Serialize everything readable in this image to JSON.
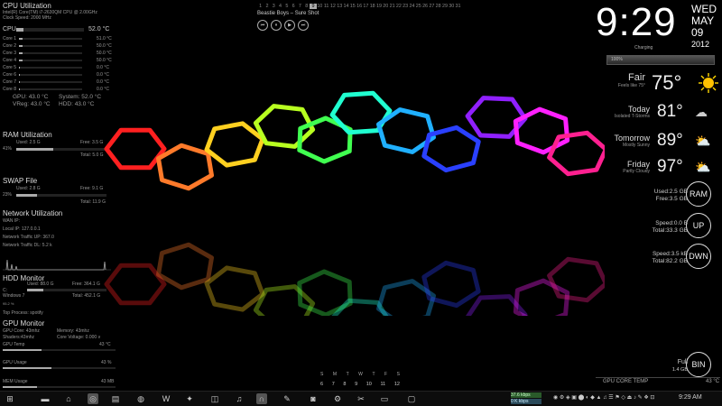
{
  "cpu": {
    "title": "CPU Utilization",
    "model": "Intel(R) Core(TM) i7-2630QM CPU @ 2.00GHz",
    "clock": "Clock Speed: 2000 MHz",
    "label": "CPU",
    "temp": "52.0 °C",
    "cores": [
      {
        "n": "Core 1",
        "t": "51.0 °C"
      },
      {
        "n": "Core 2",
        "t": "50.0 °C"
      },
      {
        "n": "Core 3",
        "t": "50.0 °C"
      },
      {
        "n": "Core 4",
        "t": "50.0 °C"
      },
      {
        "n": "Core 5",
        "t": "0.0 °C"
      },
      {
        "n": "Core 6",
        "t": "0.0 °C"
      },
      {
        "n": "Core 7",
        "t": "0.0 °C"
      },
      {
        "n": "Core 8",
        "t": "0.0 °C"
      }
    ],
    "gpu": "GPU:   43.0 °C",
    "system": "System:  52.0 °C",
    "vreg": "VReg:  43.0 °C",
    "hdd": "HDD:   43.0 °C"
  },
  "ram": {
    "title": "RAM Utilization",
    "used": "Used: 2.5 G",
    "free": "Free: 3.5 G",
    "pct": "41%",
    "total": "Total: 5.0 G",
    "fill": 0.41
  },
  "swap": {
    "title": "SWAP File",
    "used": "Used: 2.8 G",
    "free": "Free: 9.1 G",
    "pct": "23%",
    "total": "Total: 11.9 G",
    "fill": 0.23
  },
  "network": {
    "title": "Network Utilization",
    "wan": "WAN IP:",
    "local": "Local IP:     127.0.0.1",
    "up": "Network Traffic UP:    367.0",
    "dl": "Network Traffic DL:    5.2 k"
  },
  "hdd": {
    "title": "HDD Monitor",
    "used": "Used: 88.0 G",
    "free": "Free: 364.1 G",
    "drive": "C:",
    "os": "Windows 7",
    "total": "Total: 452.1 G",
    "pct": "95.2 %",
    "process": "Top Process: spotify"
  },
  "gpu": {
    "title": "GPU Monitor",
    "core": "GPU Core: 43mhz",
    "memory": "Memory: 43mhz",
    "shaders": "Shaders:43mhz",
    "voltage": "Core Voltage: 0.000 v",
    "temp_label": "GPU Temp",
    "temp": "43 °C",
    "usage_label": "GPU Usage",
    "usage": "43 %",
    "mem_label": "MEM Usage",
    "mem": "43 MB"
  },
  "music": {
    "track": "Beastie Boys – Sure Shot",
    "days": [
      "1",
      "2",
      "3",
      "4",
      "5",
      "6",
      "7",
      "8",
      "9",
      "10",
      "11",
      "12",
      "13",
      "14",
      "15",
      "16",
      "17",
      "18",
      "19",
      "20",
      "21",
      "22",
      "23",
      "24",
      "25",
      "26",
      "27",
      "28",
      "29",
      "30",
      "31"
    ],
    "today_index": 8,
    "controls": [
      "prev-icon",
      "pause-icon",
      "play-icon",
      "next-icon"
    ]
  },
  "clock": {
    "time": "9:29",
    "day": "WED",
    "month": "MAY",
    "date": "09",
    "year": "2012",
    "status": "Charging",
    "battery": "100%"
  },
  "weather": {
    "now": {
      "name": "Fair",
      "sub": "Feels like 75°",
      "temp": "75°"
    },
    "forecast": [
      {
        "name": "Today",
        "sub": "Isolated T-Storms",
        "temp": "81°",
        "icon": "storm-icon"
      },
      {
        "name": "Tomorrow",
        "sub": "Mostly Sunny",
        "temp": "89°",
        "icon": "sun-cloud-icon"
      },
      {
        "name": "Friday",
        "sub": "Partly Cloudy",
        "temp": "97°",
        "icon": "sun-cloud-icon"
      }
    ]
  },
  "meters": {
    "ram": {
      "label": "RAM",
      "l1": "Used:2.5 GB",
      "l2": "Free:3.5 GB"
    },
    "up": {
      "label": "UP",
      "l1": "Speed:0.0 B",
      "l2": "Total:33.3 GB"
    },
    "down": {
      "label": "DWN",
      "l1": "Speed:3.5 kB",
      "l2": "Total:82.2 GB"
    },
    "bin": {
      "label": "BIN",
      "l1": "Full",
      "l2": "1.4 GB"
    }
  },
  "gpu_core": {
    "label": "GPU CORE TEMP",
    "value": "43 °C"
  },
  "mini_cal": {
    "days": [
      "S",
      "M",
      "T",
      "W",
      "T",
      "F",
      "S"
    ],
    "dates": [
      "6",
      "7",
      "8",
      "9",
      "10",
      "11",
      "12"
    ]
  },
  "taskbar": {
    "time": "9:29 AM",
    "net1": "37.6 kbps",
    "net2": "0 K kbps",
    "icons": [
      "start-icon",
      "folder-icon",
      "home-icon",
      "media-icon",
      "document-icon",
      "chrome-icon",
      "word-icon",
      "game-icon",
      "gamepad-icon",
      "music-icon",
      "headphones-icon",
      "paint-icon",
      "camera-icon",
      "gear-icon",
      "tools-icon",
      "terminal-icon",
      "screen-icon"
    ]
  },
  "colors": {
    "ring": [
      "#ff2020",
      "#ff7a2a",
      "#ffd020",
      "#b8ff20",
      "#40ff50",
      "#20ffd0",
      "#20b0ff",
      "#2a40ff",
      "#9020ff",
      "#ff20ff",
      "#ff2090"
    ]
  }
}
